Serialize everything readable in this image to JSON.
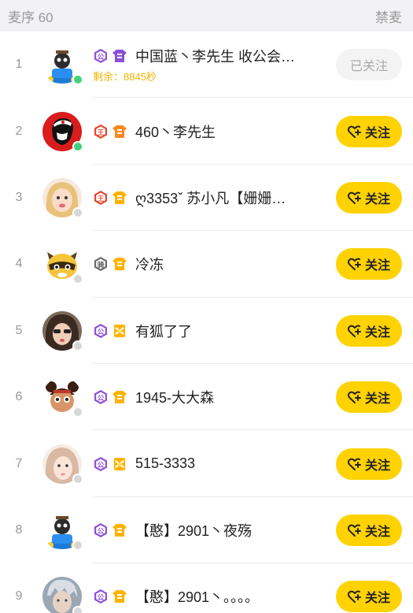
{
  "header": {
    "title": "麦序 60",
    "ban_label": "禁麦"
  },
  "colors": {
    "accent": "#ffd200",
    "timer": "#f0b400",
    "online": "#3fd27a"
  },
  "rows": [
    {
      "index": "1",
      "name": "中国蓝丶李先生  收公会…",
      "sub": "剩余：8845秒",
      "button": "已关注",
      "followed": true,
      "online": true,
      "badges": [
        "gong-badge-purple",
        "shirt-badge-purple"
      ],
      "avatar": "gun-dog-avatar"
    },
    {
      "index": "2",
      "name": "460丶李先生",
      "button": "关注",
      "followed": false,
      "online": true,
      "badges": [
        "wang-badge-red",
        "shirt-badge-orange"
      ],
      "avatar": "che-avatar"
    },
    {
      "index": "3",
      "name": "ღ3353ˇ 苏小凡【姗姗…",
      "button": "关注",
      "followed": false,
      "online": false,
      "badges": [
        "wang-badge-red",
        "shirt-badge-yellow"
      ],
      "avatar": "girl-avatar"
    },
    {
      "index": "4",
      "name": "冷冻",
      "button": "关注",
      "followed": false,
      "online": false,
      "badges": [
        "knight-badge-gray",
        "shirt-badge-yellow"
      ],
      "avatar": "raccoon-avatar"
    },
    {
      "index": "5",
      "name": "有狐了了",
      "button": "关注",
      "followed": false,
      "online": false,
      "badges": [
        "gong-badge-purple",
        "ribbon-badge-yellow"
      ],
      "avatar": "girl2-avatar"
    },
    {
      "index": "6",
      "name": "1945-大大森",
      "button": "关注",
      "followed": false,
      "online": false,
      "badges": [
        "gong-badge-purple",
        "shirt-badge-yellow"
      ],
      "avatar": "cartoon-avatar"
    },
    {
      "index": "7",
      "name": "515-3333",
      "button": "关注",
      "followed": false,
      "online": false,
      "badges": [
        "gong-badge-purple",
        "ribbon-badge-yellow"
      ],
      "avatar": "girl3-avatar"
    },
    {
      "index": "8",
      "name": "【憨】2901丶夜殇",
      "button": "关注",
      "followed": false,
      "online": false,
      "badges": [
        "gong-badge-purple",
        "shirt-badge-yellow"
      ],
      "avatar": "gun-dog-avatar"
    },
    {
      "index": "9",
      "name": "【憨】2901丶。。。。",
      "button": "关注",
      "followed": false,
      "online": false,
      "badges": [
        "gong-badge-purple",
        "shirt-badge-yellow"
      ],
      "avatar": "boy-avatar"
    }
  ]
}
